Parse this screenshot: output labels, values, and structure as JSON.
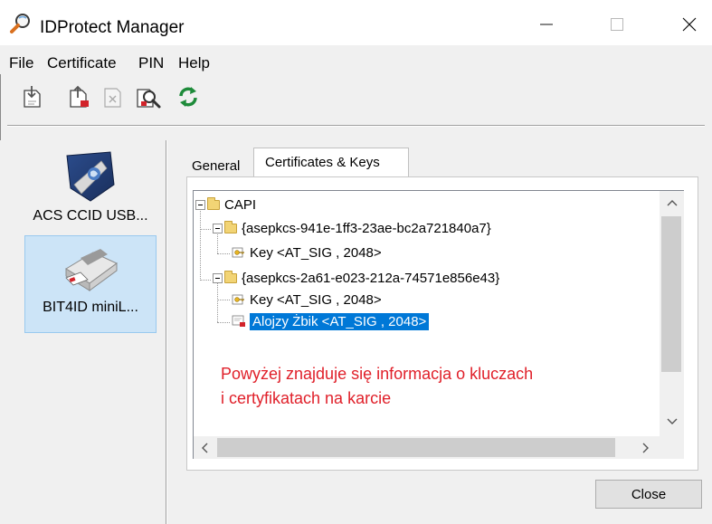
{
  "window": {
    "title": "IDProtect Manager",
    "controls": {
      "minimize": "minimize",
      "maximize": "maximize",
      "close": "close"
    }
  },
  "menu": [
    {
      "label": "File"
    },
    {
      "label": "Certificate"
    },
    {
      "label": "PIN"
    },
    {
      "label": "Help"
    }
  ],
  "toolbar": {
    "buttons": [
      {
        "icon": "import-certificate-icon"
      },
      {
        "icon": "export-certificate-icon"
      },
      {
        "icon": "delete-disabled-icon"
      },
      {
        "icon": "view-certificate-icon"
      },
      {
        "icon": "refresh-icon"
      }
    ]
  },
  "devices": [
    {
      "label": "ACS CCID USB...",
      "selected": false
    },
    {
      "label": "BIT4ID miniL...",
      "selected": true
    }
  ],
  "tabs": [
    {
      "label": "General",
      "active": false
    },
    {
      "label": "Certificates & Keys",
      "active": true
    }
  ],
  "tree": {
    "root": "CAPI",
    "containers": [
      {
        "label": "{asepkcs-941e-1ff3-23ae-bc2a721840a7}",
        "items": [
          {
            "type": "key",
            "label": "Key  <AT_SIG , 2048>"
          }
        ]
      },
      {
        "label": "{asepkcs-2a61-e023-212a-74571e856e43}",
        "items": [
          {
            "type": "key",
            "label": "Key  <AT_SIG , 2048>"
          },
          {
            "type": "certificate",
            "label": "Alojzy Żbik <AT_SIG , 2048>",
            "selected": true
          }
        ]
      }
    ]
  },
  "annotation": {
    "line1": "Powyżej znajduje się informacja o kluczach",
    "line2": "i certyfikatach na karcie",
    "color": "#e0202a"
  },
  "buttons": {
    "close": "Close"
  },
  "colors": {
    "selection": "#0078d7",
    "device_selected_bg": "#cce4f7"
  }
}
